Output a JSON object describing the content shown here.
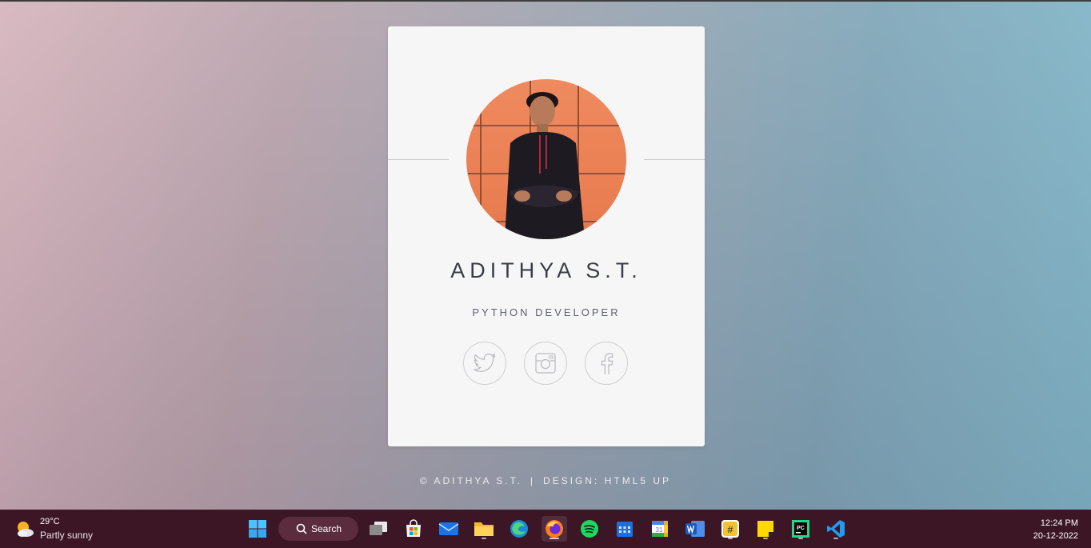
{
  "profile": {
    "name": "ADITHYA S.T.",
    "role": "PYTHON DEVELOPER",
    "socials": [
      {
        "icon": "twitter-icon",
        "label": "Twitter"
      },
      {
        "icon": "instagram-icon",
        "label": "Instagram"
      },
      {
        "icon": "facebook-icon",
        "label": "Facebook"
      }
    ]
  },
  "footer": {
    "copyright": "© ADITHYA S.T.",
    "separator": "|",
    "design": "DESIGN: HTML5 UP"
  },
  "taskbar": {
    "weather": {
      "temp": "29°C",
      "condition": "Partly sunny",
      "icon": "partly-sunny-icon"
    },
    "search_label": "Search",
    "apps": [
      "start",
      "task-view",
      "microsoft-store",
      "mail",
      "file-explorer",
      "edge",
      "firefox",
      "spotify",
      "calendar",
      "google-calendar",
      "word",
      "slack",
      "sticky-notes",
      "pycharm",
      "vscode"
    ],
    "clock": {
      "time": "12:24 PM",
      "date": "20-12-2022"
    }
  },
  "colors": {
    "card": "#f6f6f7",
    "taskbar": "#3d1626",
    "avatar_bg": "#ef8a5f"
  }
}
